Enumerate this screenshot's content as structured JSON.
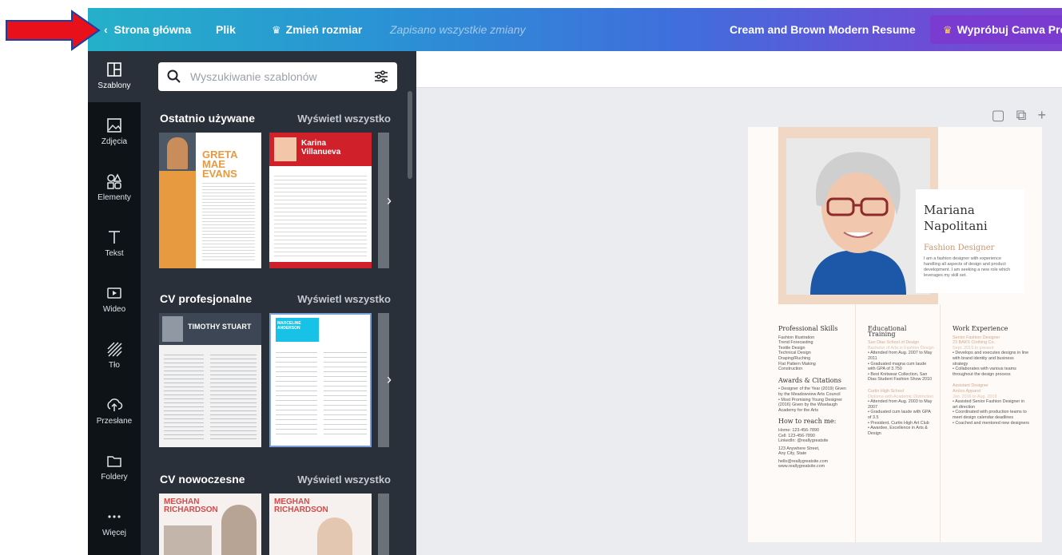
{
  "topbar": {
    "home_label": "Strona główna",
    "file_label": "Plik",
    "resize_label": "Zmień rozmiar",
    "saved_status": "Zapisano wszystkie zmiany",
    "doc_title": "Cream and Brown Modern Resume",
    "try_pro_label": "Wypróbuj Canva Pro",
    "gradient_colors": [
      "#25b0c9",
      "#7e45d0"
    ]
  },
  "annotation": {
    "arrow_color": "#e8101a"
  },
  "rail": {
    "items": [
      {
        "label": "Szablony",
        "icon": "template-icon"
      },
      {
        "label": "Zdjęcia",
        "icon": "photo-icon"
      },
      {
        "label": "Elementy",
        "icon": "shapes-icon"
      },
      {
        "label": "Tekst",
        "icon": "text-icon"
      },
      {
        "label": "Wideo",
        "icon": "video-icon"
      },
      {
        "label": "Tło",
        "icon": "background-icon"
      },
      {
        "label": "Przesłane",
        "icon": "upload-icon"
      },
      {
        "label": "Foldery",
        "icon": "folder-icon"
      },
      {
        "label": "Więcej",
        "icon": "more-icon"
      }
    ]
  },
  "panel": {
    "search_placeholder": "Wyszukiwanie szablonów",
    "sections": [
      {
        "title": "Ostatnio używane",
        "link": "Wyświetl wszystko",
        "thumbs": [
          {
            "name": "GRETA MAE EVANS"
          },
          {
            "name": "Karina Villanueva"
          }
        ]
      },
      {
        "title": "CV profesjonalne",
        "link": "Wyświetl wszystko",
        "thumbs": [
          {
            "name": "TIMOTHY STUART"
          },
          {
            "name": "MARCELINE ANDERSON"
          }
        ]
      },
      {
        "title": "CV nowoczesne",
        "link": "Wyświetl wszystko",
        "thumbs": [
          {
            "name": "MEGHAN RICHARDSON"
          },
          {
            "name": "MEGHAN RICHARDSON"
          }
        ]
      }
    ]
  },
  "resume": {
    "first_name": "Mariana",
    "last_name": "Napolitani",
    "role": "Fashion Designer",
    "summary": "I am a fashion designer with experience handling all aspects of design and product development. I am seeking a new role which leverages my skill set.",
    "skills_title": "Professional Skills",
    "skills": [
      "Fashion Illustration",
      "Trend Forecasting",
      "Textile Design",
      "Technical Design",
      "Draping/Ruching",
      "Flat Pattern Making",
      "Construction"
    ],
    "awards_title": "Awards & Citations",
    "awards": [
      "Designer of the Year (2019) Given by the Meadowview Arts Council",
      "Most Promising Young Designer (2016) Given by the Wiselaugh Academy for the Arts"
    ],
    "reach_title": "How to reach me:",
    "contact": [
      "Home:    123-456-7890",
      "Cell:      123-456-7890",
      "LinkedIn:  @reallygreatsite",
      "123 Anywhere Street,",
      "Any City, State",
      "hello@reallygreatsite.com",
      "www.reallygreatsite.com"
    ],
    "edu_title": "Educational Training",
    "edu1_school": "San Dias School of Design",
    "edu1_degree": "Bachelor of Arts in Fashion Design",
    "edu1_items": [
      "Attended from Aug. 2007 to May 2011",
      "Graduated magna cum laude with GPA of 3.750",
      "Best Knitwear Collection, San Dias Student Fashion Show 2010"
    ],
    "edu2_school": "Curtin High School",
    "edu2_degree": "Diploma with Academic Distinction",
    "edu2_items": [
      "Attended from Aug. 2003 to May 2007",
      "Graduated cum laude with GPA of 3.5",
      "President, Curtin High Art Club",
      "Awardee, Excellence in Arts & Design"
    ],
    "work_title": "Work Experience",
    "work1_role": "Senior Fashion Designer",
    "work1_company": "23 BAKS Clothing Co.",
    "work1_dates": "Sept. 2019 to present",
    "work1_items": [
      "Develops and executes designs in line with brand identity and business strategy",
      "Collaborates with various teams throughout the design process"
    ],
    "work2_role": "Assistant Designer",
    "work2_company": "Arolco Apparel",
    "work2_dates": "Jan. 2016 to Aug. 2019",
    "work2_items": [
      "Assisted Senior Fashion Designer in art direction",
      "Coordinated with production teams to meet design calendar deadlines",
      "Coached and mentored new designers"
    ]
  }
}
